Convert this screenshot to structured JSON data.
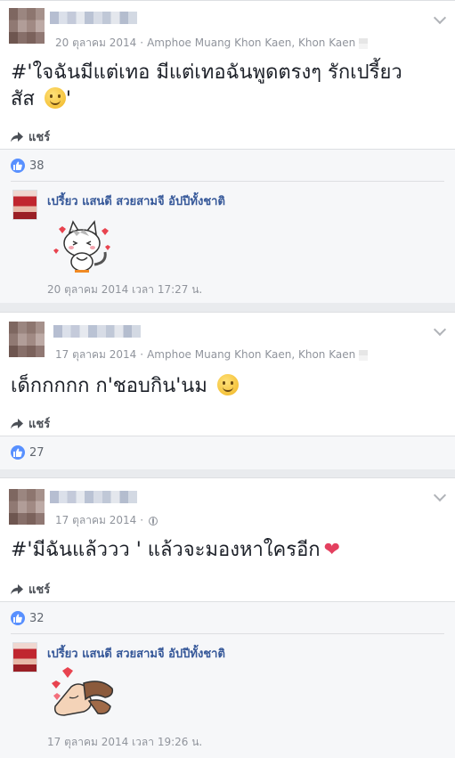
{
  "posts": [
    {
      "date": "20 ตุลาคม 2014",
      "location": "Amphoe Muang Khon Kaen, Khon Kaen",
      "text_line1": "#'ใจฉันมีแต่เทอ มีแต่เทอฉันพูดตรงๆ รักเปรี้ยว",
      "text_line2": "สัส",
      "text_after_emoji": "'",
      "share_label": "แชร์",
      "likes": "38",
      "comment": {
        "author": "เปรี้ยว แสนดี สวยสามจี อัปปีทั้งชาติ",
        "time": "20 ตุลาคม 2014 เวลา 17:27 น."
      }
    },
    {
      "date": "17 ตุลาคม 2014",
      "location": "Amphoe Muang Khon Kaen, Khon Kaen",
      "text_line1": "เด็กกกกก ก'ชอบกิน'นม",
      "share_label": "แชร์",
      "likes": "27"
    },
    {
      "date": "17 ตุลาคม 2014",
      "text_line1": "#'มีฉันแล้ววว ' แล้วจะมองหาใครอีก",
      "share_label": "แชร์",
      "likes": "32",
      "comment": {
        "author": "เปรี้ยว แสนดี สวยสามจี อัปปีทั้งชาติ",
        "time": "17 ตุลาคม 2014 เวลา 19:26 น."
      }
    }
  ],
  "icons": {
    "menu": "chevron-down-icon",
    "share": "share-arrow-icon",
    "like": "like-thumb-icon",
    "privacy": "globe-icon",
    "emoji": "smiley-emoji-icon",
    "heart": "heart-emoji-icon"
  },
  "colors": {
    "link": "#365899",
    "like_blue": "#5890ff",
    "meta_gray": "#90949c",
    "background": "#e9ebee",
    "heart": "#e4405f"
  }
}
